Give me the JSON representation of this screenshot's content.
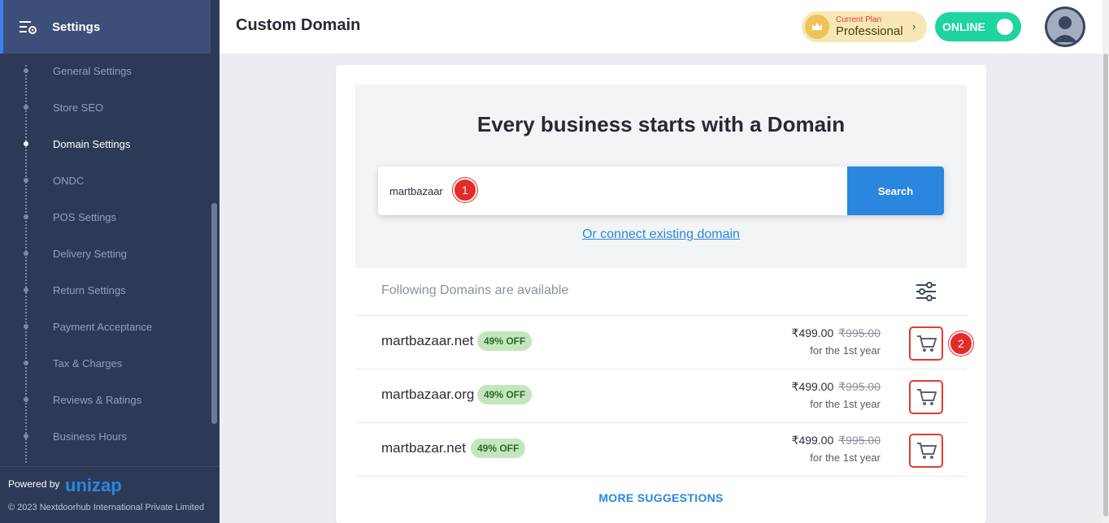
{
  "sidebar": {
    "title": "Settings",
    "items": [
      {
        "label": "General Settings"
      },
      {
        "label": "Store SEO"
      },
      {
        "label": "Domain Settings"
      },
      {
        "label": "ONDC"
      },
      {
        "label": "POS Settings"
      },
      {
        "label": "Delivery Setting"
      },
      {
        "label": "Return Settings"
      },
      {
        "label": "Payment Acceptance"
      },
      {
        "label": "Tax & Charges"
      },
      {
        "label": "Reviews & Ratings"
      },
      {
        "label": "Business Hours"
      }
    ],
    "powered_by": "Powered by",
    "brand": "unizap",
    "copyright": "© 2023 Nextdoorhub International Private Limited"
  },
  "header": {
    "title": "Custom Domain",
    "plan_label": "Current Plan",
    "plan_value": "Professional",
    "status": "ONLINE"
  },
  "hero": {
    "title": "Every business starts with a Domain",
    "search_value": "martbazaar",
    "search_button": "Search",
    "connect_link": "Or connect existing domain"
  },
  "markers": {
    "m1": "1",
    "m2": "2"
  },
  "results": {
    "heading": "Following Domains are available",
    "rows": [
      {
        "domain": "martbazaar.net",
        "discount": "49% OFF",
        "price": "₹499.00",
        "old_price": "₹995.00",
        "period": "for the 1st year"
      },
      {
        "domain": "martbazaar.org",
        "discount": "49% OFF",
        "price": "₹499.00",
        "old_price": "₹995.00",
        "period": "for the 1st year"
      },
      {
        "domain": "martbazar.net",
        "discount": "49% OFF",
        "price": "₹499.00",
        "old_price": "₹995.00",
        "period": "for the 1st year"
      }
    ],
    "more": "MORE SUGGESTIONS"
  },
  "colors": {
    "sidebar_bg": "#2c3a57",
    "accent_blue": "#2b86e0",
    "online_green": "#1ed4a0",
    "marker_red": "#e52a2a"
  }
}
